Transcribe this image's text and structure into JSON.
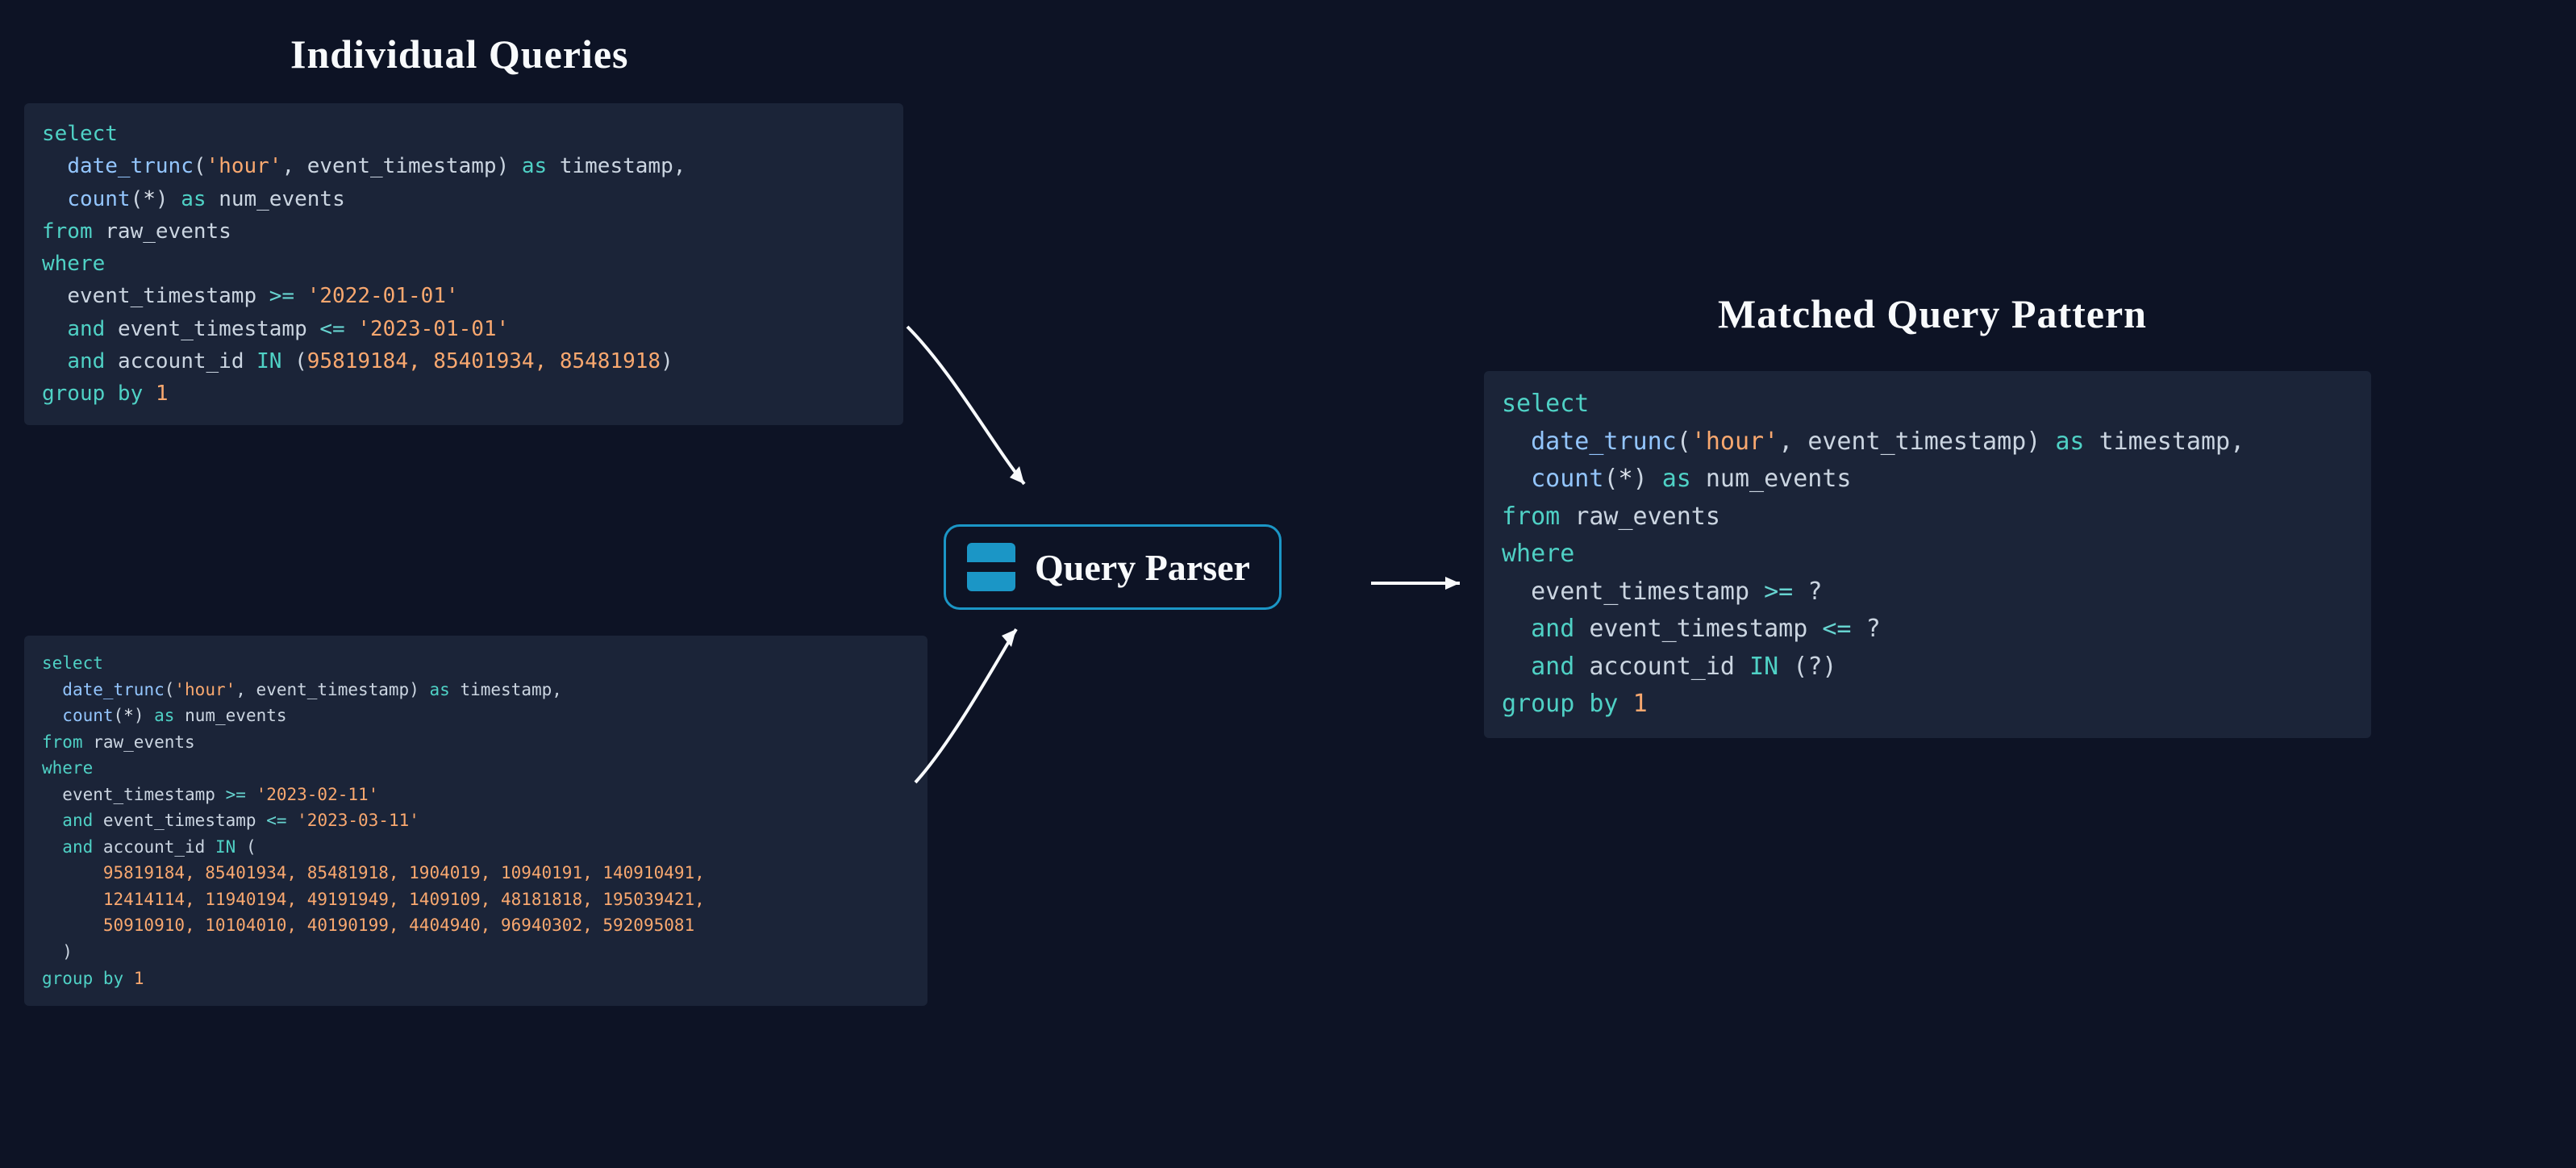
{
  "headings": {
    "left": "Individual Queries",
    "right": "Matched Query Pattern"
  },
  "parser": {
    "label": "Query Parser"
  },
  "query1": {
    "lines": [
      "select",
      "  date_trunc('hour', event_timestamp) as timestamp,",
      "  count(*) as num_events",
      "from raw_events",
      "where",
      "  event_timestamp >= '2022-01-01'",
      "  and event_timestamp <= '2023-01-01'",
      "  and account_id IN (95819184, 85401934, 85481918)",
      "group by 1"
    ],
    "date1": "'2022-01-01'",
    "date2": "'2023-01-01'",
    "ids": "95819184, 85401934, 85481918"
  },
  "query2": {
    "lines": [
      "select",
      "  date_trunc('hour', event_timestamp) as timestamp,",
      "  count(*) as num_events",
      "from raw_events",
      "where",
      "  event_timestamp >= '2023-02-11'",
      "  and event_timestamp <= '2023-03-11'",
      "  and account_id IN (",
      "      95819184, 85401934, 85481918, 1904019, 10940191, 140910491,",
      "      12414114, 11940194, 49191949, 1409109, 48181818, 195039421,",
      "      50910910, 10104010, 40190199, 4404940, 96940302, 592095081",
      "  )",
      "group by 1"
    ],
    "date1": "'2023-02-11'",
    "date2": "'2023-03-11'",
    "id_rows": [
      "95819184, 85401934, 85481918, 1904019, 10940191, 140910491,",
      "12414114, 11940194, 49191949, 1409109, 48181818, 195039421,",
      "50910910, 10104010, 40190199, 4404940, 96940302, 592095081"
    ]
  },
  "pattern": {
    "lines": [
      "select",
      "  date_trunc('hour', event_timestamp) as timestamp,",
      "  count(*) as num_events",
      "from raw_events",
      "where",
      "  event_timestamp >= ?",
      "  and event_timestamp <= ?",
      "  and account_id IN (?)",
      "group by 1"
    ]
  },
  "tokens": {
    "select": "select",
    "date_trunc": "date_trunc",
    "hour": "'hour'",
    "event_timestamp": "event_timestamp",
    "as": "as",
    "timestamp": "timestamp",
    "count": "count",
    "num_events": "num_events",
    "from": "from",
    "raw_events": "raw_events",
    "where": "where",
    "and": "and",
    "account_id": "account_id",
    "in": "IN",
    "group_by": "group by",
    "one": "1",
    "gte": ">=",
    "lte": "<=",
    "q": "?"
  }
}
